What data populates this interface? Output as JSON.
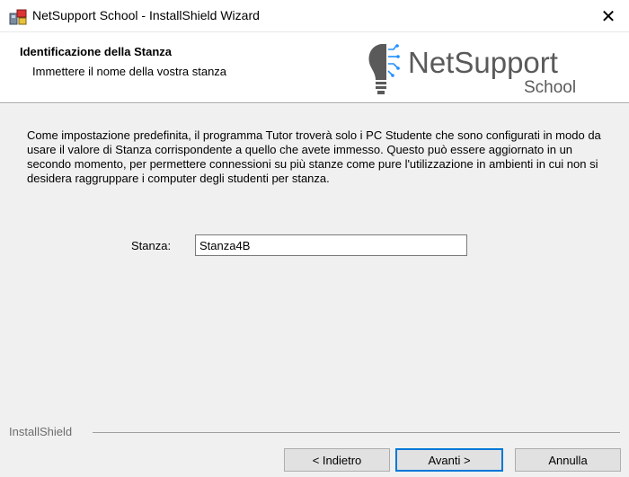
{
  "window": {
    "title": "NetSupport School - InstallShield Wizard",
    "close_glyph": "✕"
  },
  "header": {
    "heading": "Identificazione della Stanza",
    "subheading": "Immettere il nome della vostra stanza",
    "logo_main": "NetSupport",
    "logo_sub": "School"
  },
  "main": {
    "description": "Come impostazione predefinita, il programma Tutor troverà solo i PC Studente che sono configurati in modo da usare il valore di Stanza corrispondente a quello che avete immesso. Questo può essere aggiornato in un secondo momento, per permettere connessioni su più stanze come pure l'utilizzazione in ambienti in cui non si desidera raggruppare i computer degli studenti per stanza.",
    "room_label": "Stanza:",
    "room_value": "Stanza4B"
  },
  "footer": {
    "brand": "InstallShield",
    "back_label": "< Indietro",
    "next_label": "Avanti >",
    "cancel_label": "Annulla"
  },
  "colors": {
    "logo_gray": "#5a5a5a",
    "logo_blue": "#1e90ff",
    "focus_blue": "#0078d7",
    "panel_bg": "#f0f0f0"
  }
}
